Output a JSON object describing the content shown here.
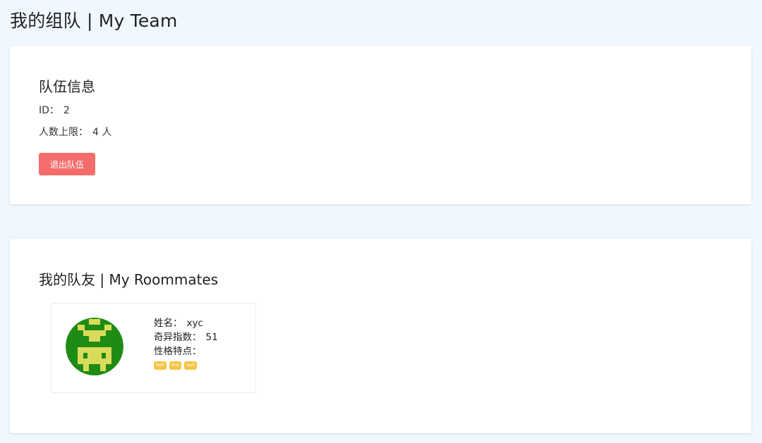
{
  "page": {
    "title": "我的组队 | My Team"
  },
  "team": {
    "title": "队伍信息",
    "id_label": "ID：",
    "id_value": "2",
    "limit_label": "人数上限：",
    "limit_value": "4 人",
    "quit_button_label": "退出队伍"
  },
  "mates": {
    "title": "我的队友 | My Roommates",
    "items": [
      {
        "name_label": "姓名：",
        "name_value": "xyc",
        "score_label": "奇异指数：",
        "score_value": "51",
        "traits_label": "性格特点：",
        "tags": [
          "test",
          "test",
          "test"
        ],
        "avatar_icon": "pixel-avatar-icon",
        "avatar_colors": {
          "bg": "#1e8c14",
          "fg": "#d9dc5a"
        }
      }
    ]
  },
  "colors": {
    "page_bg": "#f0f7ff",
    "danger": "#f56c6c",
    "tag": "#f6c343"
  }
}
